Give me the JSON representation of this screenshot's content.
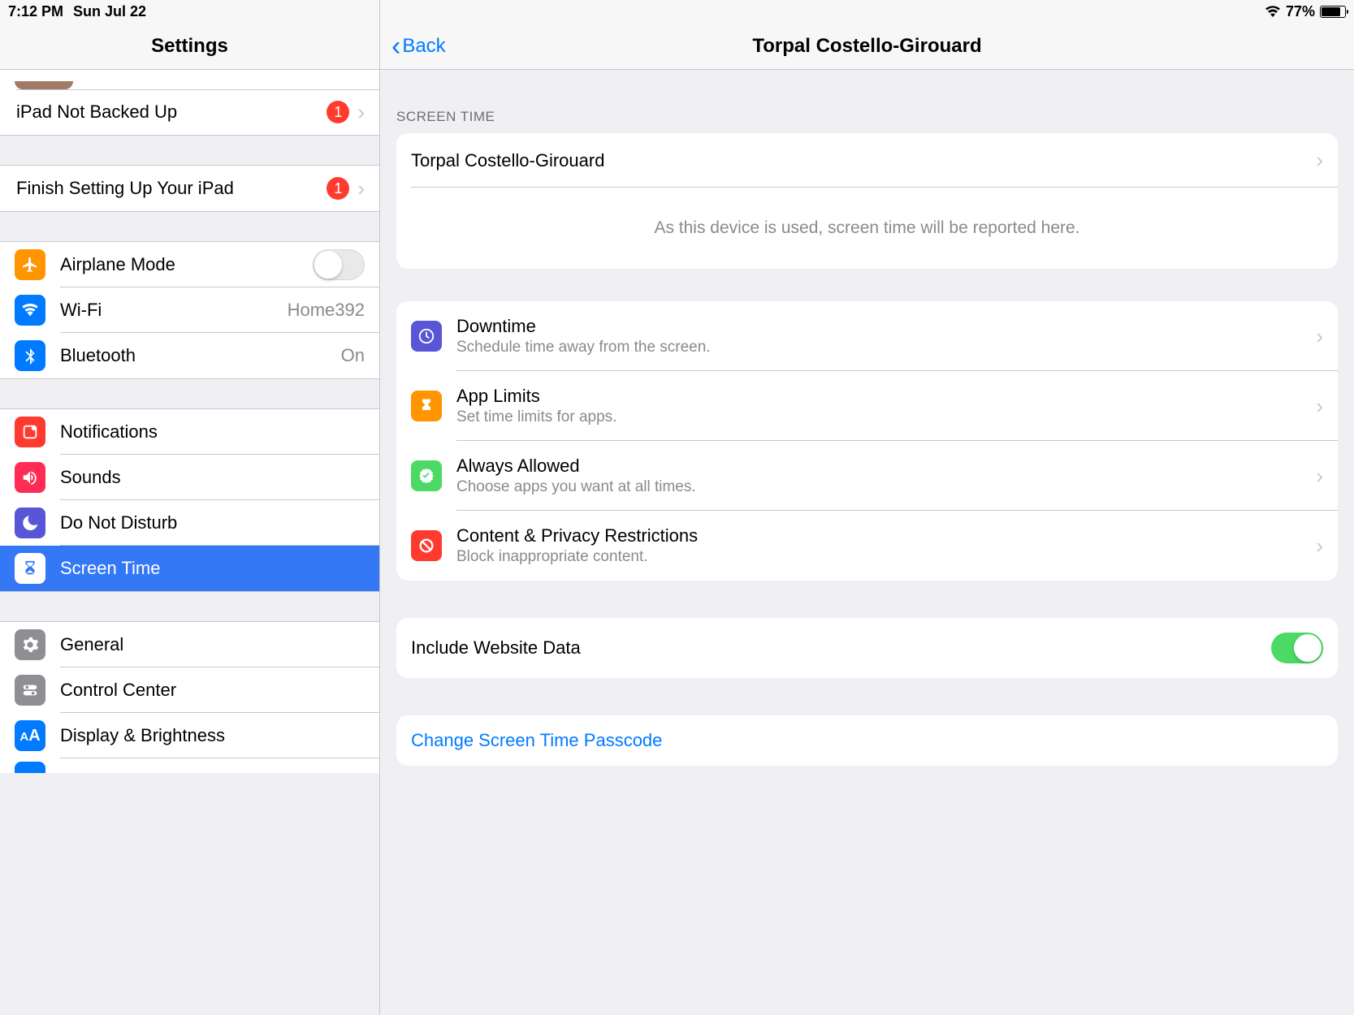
{
  "statusbar": {
    "time": "7:12 PM",
    "date": "Sun Jul 22",
    "battery_pct": "77%"
  },
  "sidebar": {
    "title": "Settings",
    "backup": {
      "label": "iPad Not Backed Up",
      "badge": "1"
    },
    "setup": {
      "label": "Finish Setting Up Your iPad",
      "badge": "1"
    },
    "airplane": {
      "label": "Airplane Mode"
    },
    "wifi": {
      "label": "Wi-Fi",
      "value": "Home392"
    },
    "bluetooth": {
      "label": "Bluetooth",
      "value": "On"
    },
    "notifications": {
      "label": "Notifications"
    },
    "sounds": {
      "label": "Sounds"
    },
    "dnd": {
      "label": "Do Not Disturb"
    },
    "screentime": {
      "label": "Screen Time"
    },
    "general": {
      "label": "General"
    },
    "controlcenter": {
      "label": "Control Center"
    },
    "display": {
      "label": "Display & Brightness"
    }
  },
  "content": {
    "back": "Back",
    "title": "Torpal Costello-Girouard",
    "section_header": "SCREEN TIME",
    "device_name": "Torpal Costello-Girouard",
    "placeholder_note": "As this device is used, screen time will be reported here.",
    "downtime": {
      "title": "Downtime",
      "sub": "Schedule time away from the screen."
    },
    "applimits": {
      "title": "App Limits",
      "sub": "Set time limits for apps."
    },
    "always": {
      "title": "Always Allowed",
      "sub": "Choose apps you want at all times."
    },
    "restrictions": {
      "title": "Content & Privacy Restrictions",
      "sub": "Block inappropriate content."
    },
    "include_website": "Include Website Data",
    "change_passcode": "Change Screen Time Passcode"
  }
}
